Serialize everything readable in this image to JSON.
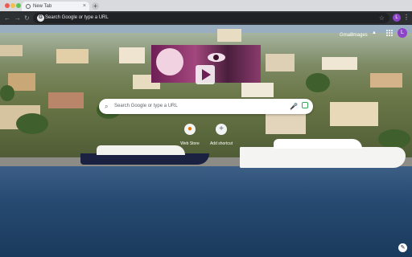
{
  "window": {
    "tab": {
      "title": "New Tab",
      "close_glyph": "×",
      "favicon": "globe-icon"
    },
    "new_tab_glyph": "+",
    "controls": {
      "close_color": "#ee5a52",
      "minimize_color": "#f5be4f",
      "maximize_color": "#5fc454"
    }
  },
  "toolbar": {
    "back_glyph": "←",
    "forward_glyph": "→",
    "reload_glyph": "↻",
    "omnibox_placeholder": "Search Google or type a URL",
    "omnibox_icon": "G",
    "bookmark_glyph": "☆",
    "profile_initial": "L",
    "menu_glyph": "⋮"
  },
  "ntp": {
    "links": {
      "gmail": "Gmail",
      "images": "Images"
    },
    "avatar_initial": "L",
    "search": {
      "placeholder": "Search Google or type a URL",
      "icon_glyph": "⌕",
      "mic_glyph": "🎤"
    },
    "shortcuts": [
      {
        "label": "Web Store",
        "glyph": "●"
      },
      {
        "label": "Add shortcut",
        "glyph": "+"
      }
    ],
    "customize_glyph": "✎"
  },
  "colors": {
    "accent": "#8e44c8",
    "toolbar": "#2d3033",
    "titlebar": "#d8dadd"
  }
}
